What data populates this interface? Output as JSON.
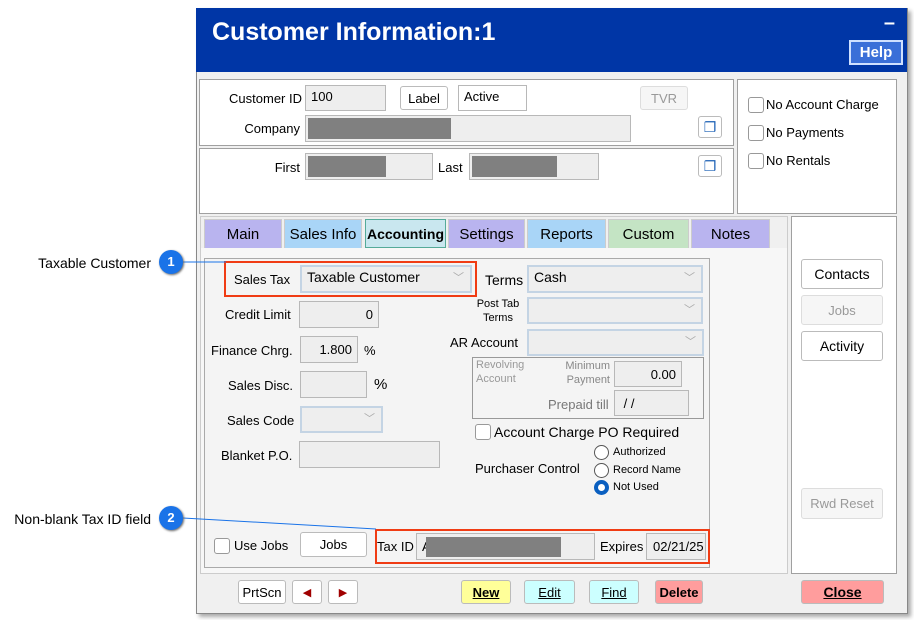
{
  "window": {
    "title": "Customer Information:1",
    "minimize_label": "–",
    "help_label": "Help"
  },
  "header": {
    "customer_id_label": "Customer ID",
    "customer_id": "100",
    "label_button": "Label",
    "status": "Active",
    "tvr_button": "TVR",
    "company_label": "Company",
    "first_label": "First",
    "last_label": "Last"
  },
  "flags": [
    {
      "label": "No Account Charge",
      "checked": false
    },
    {
      "label": "No Payments",
      "checked": false
    },
    {
      "label": "No Rentals",
      "checked": false
    }
  ],
  "tabs": [
    {
      "label": "Main",
      "color": "#b9b4ef"
    },
    {
      "label": "Sales Info",
      "color": "#a9d5f7"
    },
    {
      "label": "Accounting",
      "color": "#c9e7ef",
      "selected": true
    },
    {
      "label": "Settings",
      "color": "#b9b4ef"
    },
    {
      "label": "Reports",
      "color": "#a9d5f7"
    },
    {
      "label": "Custom",
      "color": "#c4e4c4"
    },
    {
      "label": "Notes",
      "color": "#b9b4ef"
    }
  ],
  "accounting": {
    "sales_tax_label": "Sales Tax",
    "sales_tax": "Taxable Customer",
    "terms_label": "Terms",
    "terms": "Cash",
    "post_tab_terms_label": "Post Tab Terms",
    "post_tab_terms": "",
    "credit_limit_label": "Credit Limit",
    "credit_limit": "0",
    "ar_account_label": "AR Account",
    "ar_account": "",
    "finance_chrg_label": "Finance Chrg.",
    "finance_chrg": "1.800",
    "pct": "%",
    "revolving_label": "Revolving Account",
    "min_payment_label": "Minimum Payment",
    "min_payment": "0.00",
    "prepaid_till_label": "Prepaid till",
    "prepaid_till": " / /",
    "sales_disc_label": "Sales Disc.",
    "sales_disc": "",
    "sales_code_label": "Sales Code",
    "po_required_label": "Account Charge PO Required",
    "blanket_po_label": "Blanket P.O.",
    "blanket_po": "",
    "purchaser_control_label": "Purchaser Control",
    "purchaser_options": [
      {
        "label": "Authorized",
        "selected": false
      },
      {
        "label": "Record Name",
        "selected": false
      },
      {
        "label": "Not Used",
        "selected": true
      }
    ],
    "use_jobs_label": "Use Jobs",
    "jobs_button": "Jobs",
    "tax_id_label": "Tax ID",
    "tax_id": "AE-",
    "expires_label": "Expires",
    "expires": "02/21/25"
  },
  "side_buttons": {
    "contacts": "Contacts",
    "jobs": "Jobs",
    "activity": "Activity",
    "rwd_reset": "Rwd Reset"
  },
  "footer": {
    "prtscn": "PrtScn",
    "new": "New",
    "edit": "Edit",
    "find": "Find",
    "delete": "Delete",
    "close": "Close"
  },
  "callouts": [
    {
      "number": "1",
      "text": "Taxable Customer"
    },
    {
      "number": "2",
      "text": "Non-blank Tax ID field"
    }
  ],
  "colors": {
    "title_bar": "#0036a6",
    "highlight": "#f03c14",
    "callout": "#1a73e8",
    "new": "#ffff99",
    "edit_find": "#ccffff",
    "delete_close": "#ff9d9d"
  }
}
